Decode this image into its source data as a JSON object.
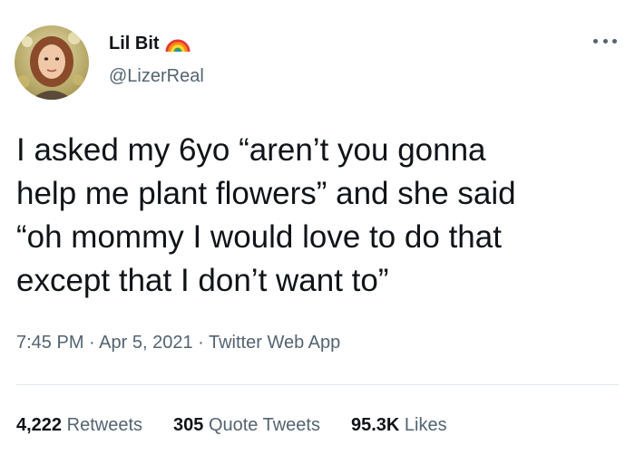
{
  "author": {
    "display_name": "Lil Bit",
    "handle": "@LizerReal",
    "badge_icon": "rainbow-icon",
    "avatar_icon": "profile-avatar"
  },
  "menu": {
    "more_icon": "more-options-icon"
  },
  "tweet": {
    "text_lines": [
      "I asked my 6yo “aren’t you gonna",
      "help me plant flowers” and she said",
      "“oh mommy I would love to do that",
      "except that I don’t want to”"
    ]
  },
  "meta": {
    "time": "7:45 PM",
    "separator": " · ",
    "date": "Apr 5, 2021",
    "source": "Twitter Web App"
  },
  "stats": {
    "retweets": {
      "count": "4,222",
      "label": "Retweets"
    },
    "quotes": {
      "count": "305",
      "label": "Quote Tweets"
    },
    "likes": {
      "count": "95.3K",
      "label": "Likes"
    }
  },
  "colors": {
    "primary_text": "#0f1419",
    "secondary_text": "#536471",
    "divider": "#e1e8ed",
    "background": "#ffffff"
  }
}
